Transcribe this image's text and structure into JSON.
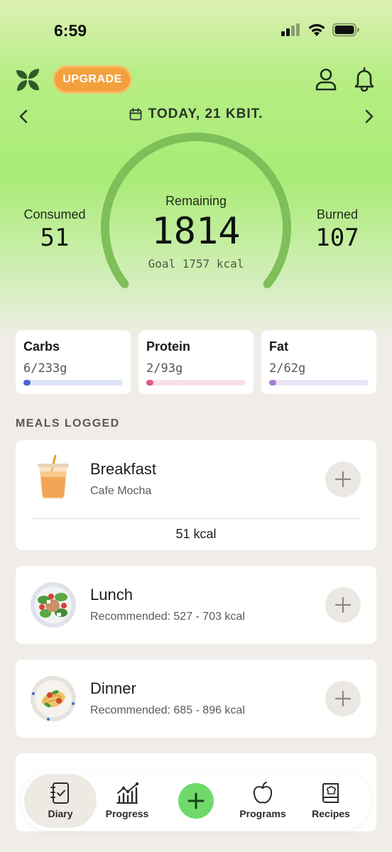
{
  "status_bar": {
    "time": "6:59"
  },
  "header": {
    "upgrade_label": "UPGRADE",
    "date": "TODAY, 21 KBIT."
  },
  "summary": {
    "consumed_label": "Consumed",
    "consumed_value": "51",
    "remaining_label": "Remaining",
    "remaining_value": "1814",
    "goal_text": "Goal 1757 kcal",
    "burned_label": "Burned",
    "burned_value": "107"
  },
  "macros": [
    {
      "name": "Carbs",
      "value": "6/233g",
      "fraction": 0.026,
      "color": "#4a64d8",
      "track": "#dfe4f8"
    },
    {
      "name": "Protein",
      "value": "2/93g",
      "fraction": 0.022,
      "color": "#df5a8a",
      "track": "#f8dfe8"
    },
    {
      "name": "Fat",
      "value": "2/62g",
      "fraction": 0.032,
      "color": "#a47fd4",
      "track": "#ebe4f6"
    }
  ],
  "meals_section_title": "MEALS LOGGED",
  "meals": [
    {
      "name": "Breakfast",
      "subtitle": "Cafe Mocha",
      "kcal": "51 kcal"
    },
    {
      "name": "Lunch",
      "subtitle": "Recommended: 527 - 703  kcal"
    },
    {
      "name": "Dinner",
      "subtitle": "Recommended: 685 - 896  kcal"
    }
  ],
  "tabs": [
    {
      "label": "Diary",
      "icon": "diary-icon",
      "active": true
    },
    {
      "label": "Progress",
      "icon": "progress-icon"
    },
    {
      "label": "Programs",
      "icon": "apple-icon"
    },
    {
      "label": "Recipes",
      "icon": "recipe-book-icon"
    }
  ],
  "colors": {
    "accent_green": "#6fda6a",
    "upgrade_orange": "#f3a13e",
    "logo_green": "#2e5a2a"
  }
}
